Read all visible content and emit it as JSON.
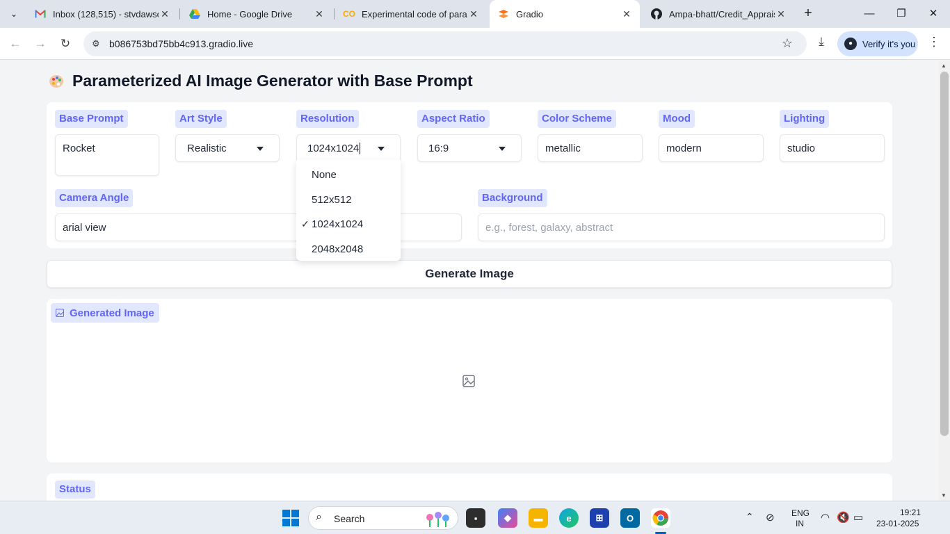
{
  "browser": {
    "tabs": [
      {
        "label": "Inbox (128,515) - stvdawson",
        "icon": "gmail-icon",
        "active": false
      },
      {
        "label": "Home - Google Drive",
        "icon": "google-drive-icon",
        "active": false
      },
      {
        "label": "Experimental code of param",
        "icon": "colab-icon",
        "active": false
      },
      {
        "label": "Gradio",
        "icon": "gradio-icon",
        "active": true
      },
      {
        "label": "Ampa-bhatt/Credit_Apprais",
        "icon": "github-icon",
        "active": false
      }
    ],
    "url": "b086753bd75bb4c913.gradio.live",
    "verify_label": "Verify it's you"
  },
  "app": {
    "title": "Parameterized AI Image Generator with Base Prompt",
    "fields": {
      "base_prompt": {
        "label": "Base Prompt",
        "value": "Rocket"
      },
      "art_style": {
        "label": "Art Style",
        "value": "Realistic"
      },
      "resolution": {
        "label": "Resolution",
        "value": "1024x1024"
      },
      "aspect_ratio": {
        "label": "Aspect Ratio",
        "value": "16:9"
      },
      "color_scheme": {
        "label": "Color Scheme",
        "value": "metallic"
      },
      "mood": {
        "label": "Mood",
        "value": "modern"
      },
      "lighting": {
        "label": "Lighting",
        "value": "studio"
      },
      "camera_angle": {
        "label": "Camera Angle",
        "value": "arial view"
      },
      "background": {
        "label": "Background",
        "placeholder": "e.g., forest, galaxy, abstract"
      }
    },
    "resolution_options": [
      {
        "label": "None",
        "selected": false
      },
      {
        "label": "512x512",
        "selected": false
      },
      {
        "label": "1024x1024",
        "selected": true
      },
      {
        "label": "2048x2048",
        "selected": false
      }
    ],
    "check_mark": "✓",
    "generate_label": "Generate Image",
    "output_label": "Generated Image",
    "status_label": "Status"
  },
  "taskbar": {
    "search_label": "Search",
    "lang_line1": "ENG",
    "lang_line2": "IN",
    "time": "19:21",
    "date": "23-01-2025"
  },
  "colors": {
    "accent": "#6366f1",
    "chip_bg": "#e0e7ff"
  }
}
